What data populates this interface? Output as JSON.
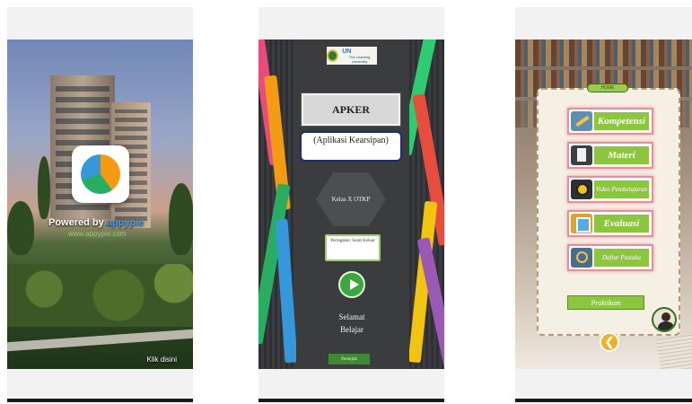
{
  "screens": {
    "splash": {
      "powered_by": "Powered by",
      "powered_brand": "appypie",
      "url": "www.appypie.com",
      "tap_hint": "Klik disini"
    },
    "home": {
      "logo_text": "The Learning University",
      "logo_badge": "UN",
      "title": "APKER",
      "subtitle": "(Aplikasi Kearsipan)",
      "class_info": "Kelas X OTKP",
      "warning_text": "Peringatan: Surat Keluar",
      "welcome": "Selamat Belajar",
      "help_button": "Petunjuk"
    },
    "menu": {
      "home_tag": "HOME",
      "items": [
        {
          "label": "Kompetensi",
          "icon": "pencil-icon"
        },
        {
          "label": "Materi",
          "icon": "document-icon"
        },
        {
          "label": "Video Pembelajaran",
          "icon": "play-icon"
        },
        {
          "label": "Evaluasi",
          "icon": "image-icon"
        },
        {
          "label": "Daftar Pustaka",
          "icon": "magnifier-icon"
        }
      ],
      "praktikum": "Praktikum",
      "back_icon": "back-arrow-icon"
    }
  },
  "colors": {
    "menu_green": "#8cc63f",
    "button_green": "#3aa83a",
    "title_border": "#1d2b78",
    "back_orange": "#f0b020"
  }
}
